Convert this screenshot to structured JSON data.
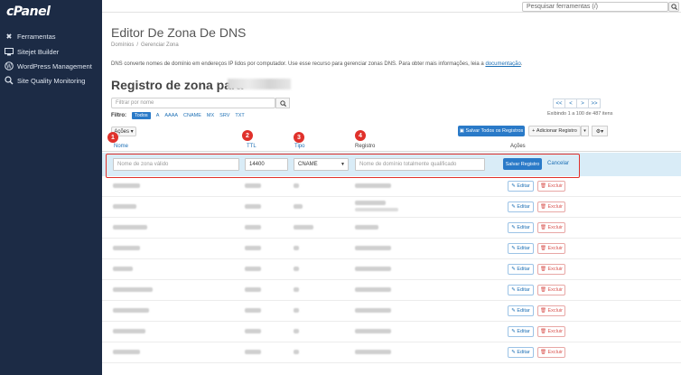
{
  "sidebar": {
    "logo": "cPanel",
    "items": [
      {
        "label": "Ferramentas",
        "icon": "tools-icon"
      },
      {
        "label": "Sitejet Builder",
        "icon": "monitor-icon"
      },
      {
        "label": "WordPress Management",
        "icon": "wordpress-icon"
      },
      {
        "label": "Site Quality Monitoring",
        "icon": "monitoring-icon"
      }
    ]
  },
  "topbar": {
    "search_placeholder": "Pesquisar ferramentas (/)"
  },
  "page": {
    "title": "Editor De Zona De DNS",
    "breadcrumb": [
      "Domínios",
      "Gerenciar Zona"
    ],
    "description": "DNS converte nomes de domínio em endereços IP lidos por computador. Use esse recurso para gerenciar zonas DNS. Para obter mais informações, leia a ",
    "description_link": "documentação",
    "section_title": "Registro de zona para"
  },
  "filter": {
    "placeholder": "Filtrar por nome",
    "label": "Filtro:",
    "types": [
      "Todos",
      "A",
      "AAAA",
      "CNAME",
      "MX",
      "SRV",
      "TXT"
    ],
    "active": "Todos"
  },
  "pager": {
    "first": "<<",
    "prev": "<",
    "next": ">",
    "last": ">>",
    "showing": "Exibindo 1 a 100 de 487 itens"
  },
  "toolbar": {
    "actions": "Ações",
    "save_all": "Salvar Todos os Registros",
    "add_record": "Adicionar Registro"
  },
  "table": {
    "headers": {
      "name": "Nome",
      "ttl": "TTL",
      "type": "Tipo",
      "record": "Registro",
      "actions": "Ações"
    }
  },
  "edit_row": {
    "name_placeholder": "Nome de zona válido",
    "ttl_value": "14400",
    "type_value": "CNAME",
    "record_placeholder": "Nome de domínio totalmente qualificado",
    "save": "Salvar Registro",
    "cancel": "Cancelar"
  },
  "row_buttons": {
    "edit": "✎ Editar",
    "delete": "🗑 Excluir"
  },
  "markers": [
    "1",
    "2",
    "3",
    "4"
  ],
  "colors": {
    "sidebar": "#1c2b45",
    "primary": "#2a7ac8",
    "marker": "#e0312b",
    "edit_row": "#d9ecf7"
  }
}
